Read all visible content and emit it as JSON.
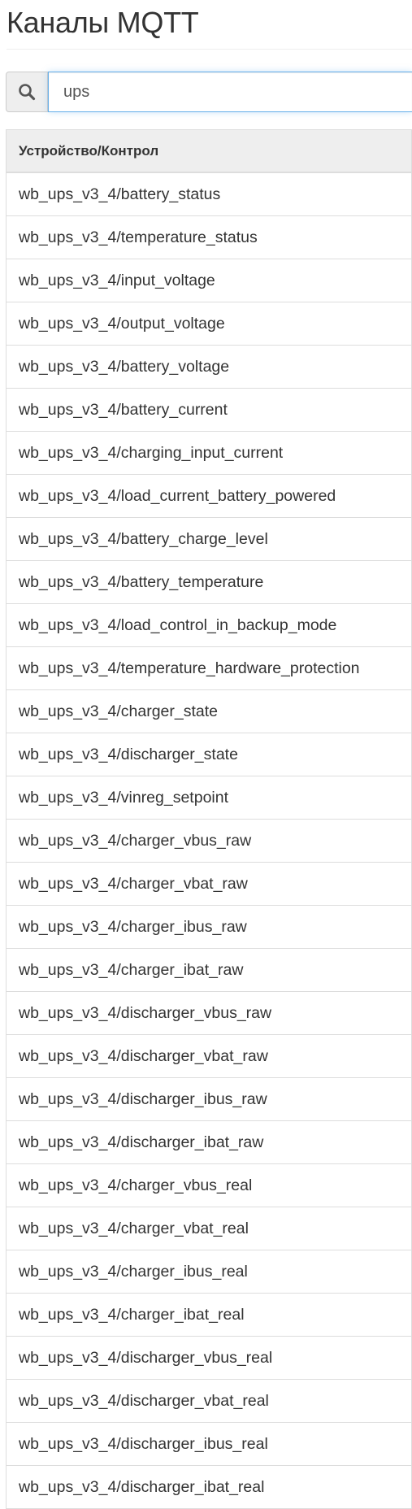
{
  "page": {
    "title": "Каналы MQTT"
  },
  "search": {
    "icon": "search-icon",
    "value": "ups"
  },
  "table": {
    "columns": [
      "Устройство/Контрол"
    ],
    "rows": [
      "wb_ups_v3_4/battery_status",
      "wb_ups_v3_4/temperature_status",
      "wb_ups_v3_4/input_voltage",
      "wb_ups_v3_4/output_voltage",
      "wb_ups_v3_4/battery_voltage",
      "wb_ups_v3_4/battery_current",
      "wb_ups_v3_4/charging_input_current",
      "wb_ups_v3_4/load_current_battery_powered",
      "wb_ups_v3_4/battery_charge_level",
      "wb_ups_v3_4/battery_temperature",
      "wb_ups_v3_4/load_control_in_backup_mode",
      "wb_ups_v3_4/temperature_hardware_protection",
      "wb_ups_v3_4/charger_state",
      "wb_ups_v3_4/discharger_state",
      "wb_ups_v3_4/vinreg_setpoint",
      "wb_ups_v3_4/charger_vbus_raw",
      "wb_ups_v3_4/charger_vbat_raw",
      "wb_ups_v3_4/charger_ibus_raw",
      "wb_ups_v3_4/charger_ibat_raw",
      "wb_ups_v3_4/discharger_vbus_raw",
      "wb_ups_v3_4/discharger_vbat_raw",
      "wb_ups_v3_4/discharger_ibus_raw",
      "wb_ups_v3_4/discharger_ibat_raw",
      "wb_ups_v3_4/charger_vbus_real",
      "wb_ups_v3_4/charger_vbat_real",
      "wb_ups_v3_4/charger_ibus_real",
      "wb_ups_v3_4/charger_ibat_real",
      "wb_ups_v3_4/discharger_vbus_real",
      "wb_ups_v3_4/discharger_vbat_real",
      "wb_ups_v3_4/discharger_ibus_real",
      "wb_ups_v3_4/discharger_ibat_real"
    ]
  }
}
